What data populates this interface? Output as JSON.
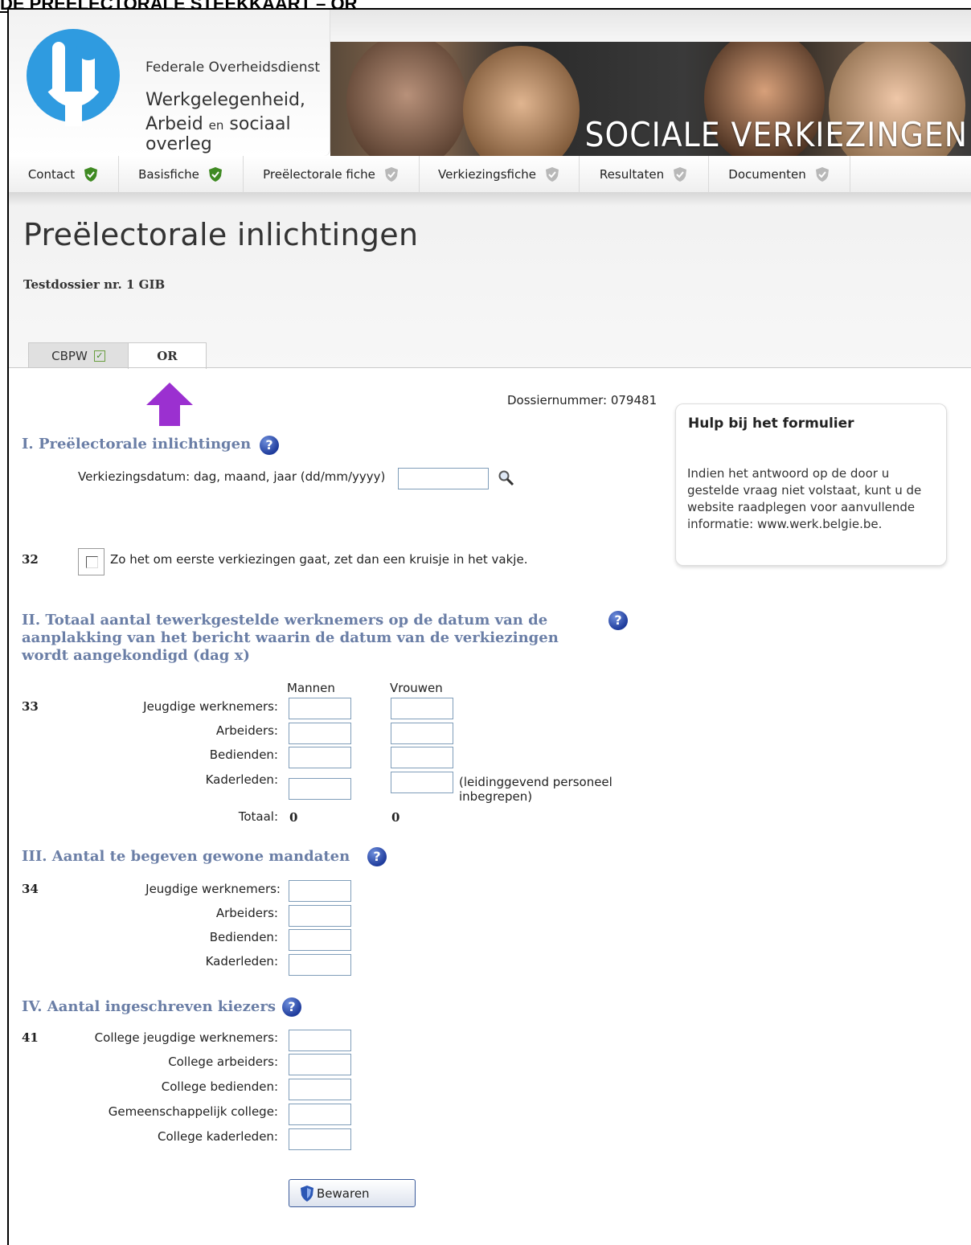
{
  "doc_caption": "DE PREËLECTORALE STEEKKAART – OR",
  "header": {
    "org_line1": "Federale Overheidsdienst",
    "org_line2": "Werkgelegenheid,",
    "org_line3_a": "Arbeid ",
    "org_line3_en": "en",
    "org_line3_b": " sociaal overleg",
    "banner_title": "SOCIALE VERKIEZINGEN"
  },
  "nav": [
    {
      "label": "Contact",
      "status": "complete"
    },
    {
      "label": "Basisfiche",
      "status": "complete"
    },
    {
      "label": "Preëlectorale fiche",
      "status": "incomplete"
    },
    {
      "label": "Verkiezingsfiche",
      "status": "incomplete"
    },
    {
      "label": "Resultaten",
      "status": "incomplete"
    },
    {
      "label": "Documenten",
      "status": "incomplete"
    }
  ],
  "page": {
    "title": "Preëlectorale inlichtingen",
    "dossier_name": "Testdossier nr. 1 GIB",
    "dossiernummer": "Dossiernummer: 079481"
  },
  "tabs": [
    {
      "label": "CBPW",
      "checked": true
    },
    {
      "label": "OR",
      "active": true
    }
  ],
  "help": {
    "title": "Hulp bij het formulier",
    "text": "Indien het antwoord op de door u gestelde vraag niet volstaat, kunt u de website raadplegen voor aanvullende informatie: www.werk.belgie.be."
  },
  "section1": {
    "title": "I. Preëlectorale inlichtingen",
    "date_label": "Verkiezingsdatum: dag, maand, jaar (dd/mm/yyyy)",
    "date_value": "",
    "row_num": "32",
    "checkbox_label": "Zo het om eerste verkiezingen gaat, zet dan een kruisje in het vakje."
  },
  "section2": {
    "title": "II. Totaal aantal tewerkgestelde werknemers op de datum van de aanplakking van het bericht waarin de datum van de verkiezingen wordt aangekondigd (dag x)",
    "row_num": "33",
    "col_men": "Mannen",
    "col_women": "Vrouwen",
    "labels": [
      "Jeugdige werknemers:",
      "Arbeiders:",
      "Bedienden:",
      "Kaderleden:"
    ],
    "note": "(leidinggevend personeel inbegrepen)",
    "total_label": "Totaal:",
    "total_men": "0",
    "total_women": "0"
  },
  "section3": {
    "title": "III. Aantal te begeven gewone mandaten",
    "row_num": "34",
    "labels": [
      "Jeugdige werknemers:",
      "Arbeiders:",
      "Bedienden:",
      "Kaderleden:"
    ]
  },
  "section4": {
    "title": "IV. Aantal ingeschreven kiezers",
    "row_num": "41",
    "labels": [
      "College jeugdige werknemers:",
      "College arbeiders:",
      "College bedienden:",
      "Gemeenschappelijk college:",
      "College kaderleden:"
    ]
  },
  "save_label": "Bewaren",
  "colors": {
    "section_heading": "#6a7ea6",
    "complete_check": "#3f8a22",
    "arrow": "#9b30d0"
  }
}
